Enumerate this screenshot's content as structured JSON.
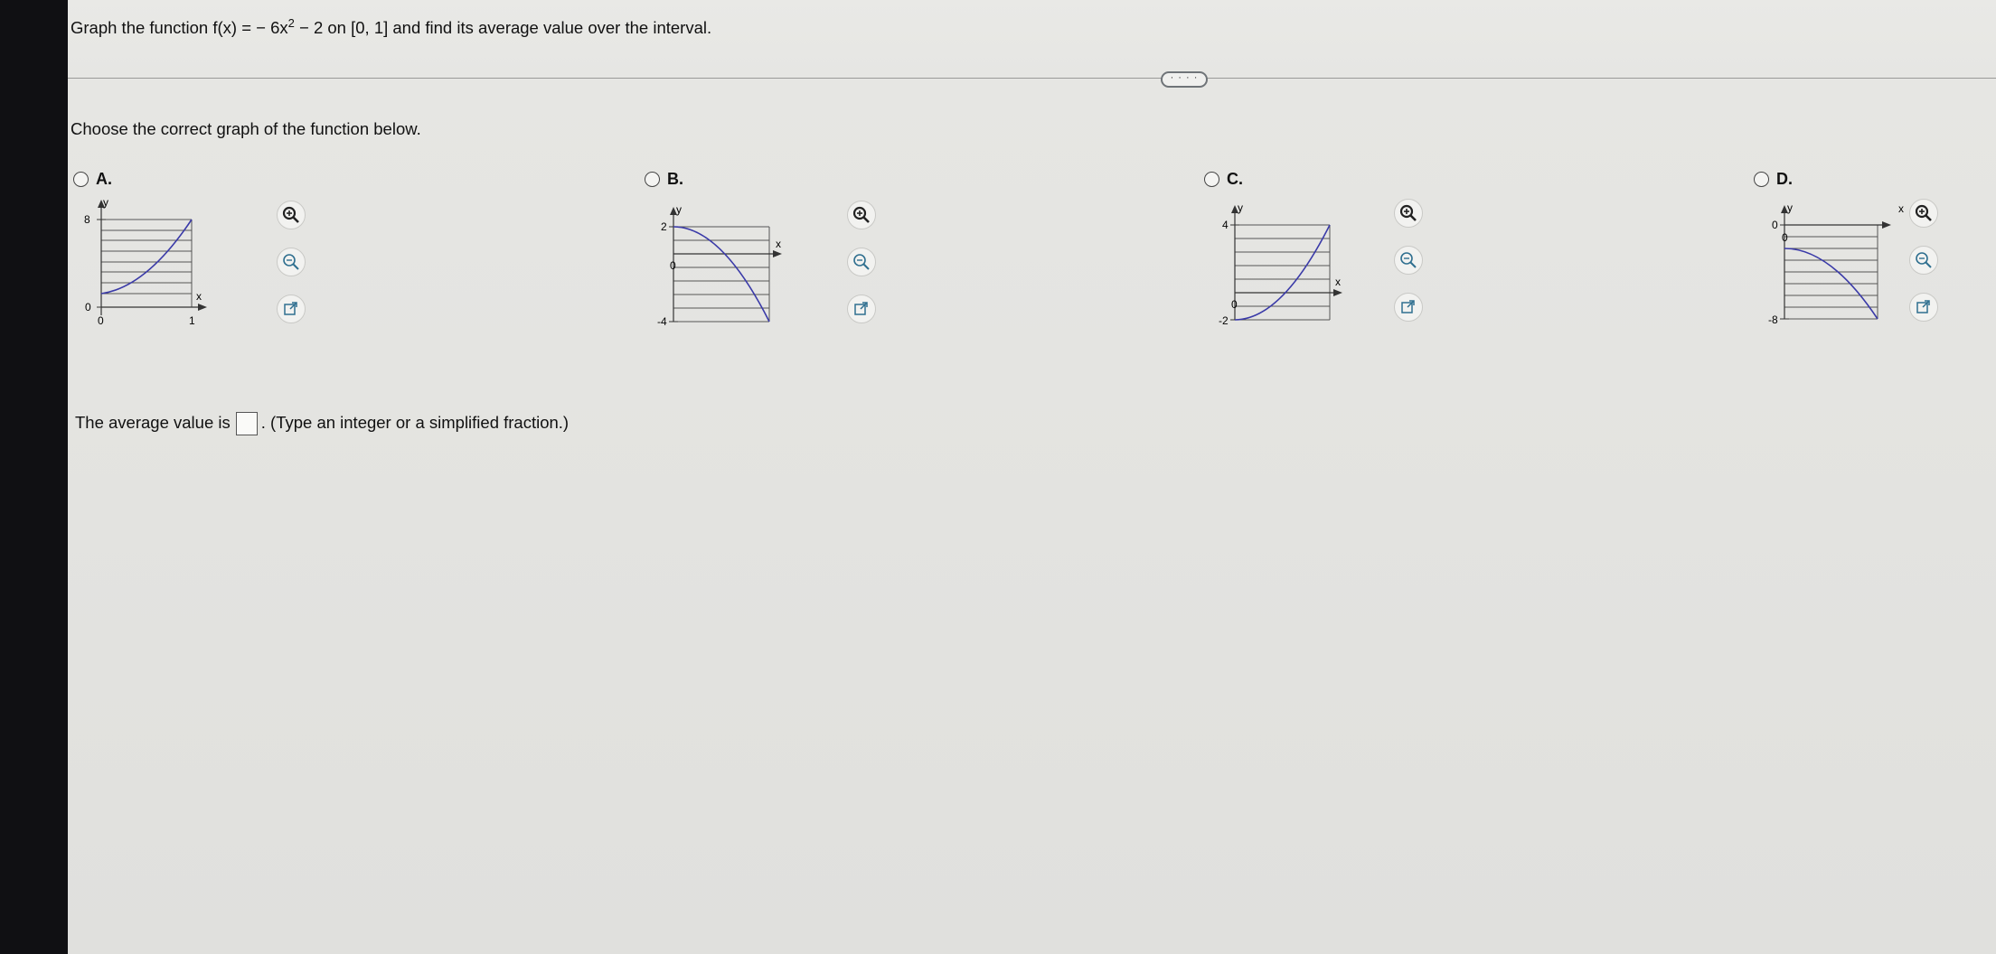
{
  "question": {
    "prefix": "Graph the function f(x) = − 6x",
    "exponent": "2",
    "suffix": " − 2 on [0, 1] and find its average value over the interval."
  },
  "more_button": "· · · ·",
  "prompt": "Choose the correct graph of the function below.",
  "options": [
    {
      "label": "A.",
      "y_top": "8",
      "y_bottom": "0",
      "x_left": "0",
      "x_right": "1",
      "x_axis": "x",
      "y_axis": "y"
    },
    {
      "label": "B.",
      "y_top": "2",
      "y_bottom": "-4",
      "x_left": "0",
      "x_axis": "x",
      "y_axis": "y"
    },
    {
      "label": "C.",
      "y_top": "4",
      "y_bottom": "-2",
      "x_left": "0",
      "x_axis": "x",
      "y_axis": "y"
    },
    {
      "label": "D.",
      "y_top": "0",
      "y_bottom": "-8",
      "x_left": "0",
      "x_axis": "x",
      "y_axis": "y"
    }
  ],
  "answer": {
    "prefix": "The average value is",
    "suffix": ". (Type an integer or a simplified fraction.)"
  },
  "icons": [
    "zoom-in-icon",
    "zoom-out-icon",
    "open-external-icon"
  ],
  "colors": {
    "curve": "#3a3aa8",
    "grid": "#555555"
  }
}
